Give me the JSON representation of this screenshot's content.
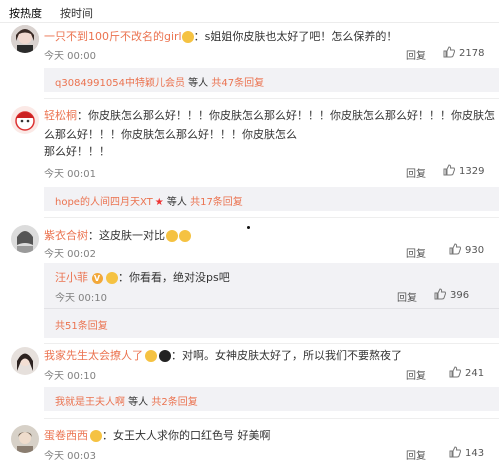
{
  "sort": {
    "hot": "按热度",
    "time": "按时间"
  },
  "c1": {
    "user": "一只不到100斤不改名的girl",
    "text": "：s姐姐你皮肤也太好了吧！怎么保养的！",
    "time": "今天 00:00",
    "reply": "回复",
    "likes": "2178",
    "sub_user": "q3084991054中特颖儿会员",
    "sub_mid": " 等人 ",
    "sub_count": "共47条回复"
  },
  "c2": {
    "user": "轻松桐",
    "text1": "：你皮肤怎么那么好！！！你皮肤怎么那么好！！！你皮肤怎么那么好！！！你皮肤怎么那么好！！！你皮肤怎么那么好！！！你皮肤怎么",
    "text2": "那么好！！！",
    "time": "今天 00:01",
    "reply": "回复",
    "likes": "1329",
    "sub_user": "hope的人间四月天XT",
    "sub_mid": " 等人 ",
    "sub_count": "共17条回复"
  },
  "c3": {
    "user": "紫衣合树",
    "text": "：这皮肤一对比",
    "time": "今天 00:02",
    "reply": "回复",
    "likes": "930",
    "r_user": "汪小菲",
    "r_text": "：你看看，绝对没ps吧",
    "r_time": "今天 00:10",
    "r_reply": "回复",
    "r_likes": "396",
    "more": "共51条回复"
  },
  "c4": {
    "user": "我家先生太会撩人了",
    "text": "：对啊。女神皮肤太好了，所以我们不要熬夜了",
    "time": "今天 00:10",
    "reply": "回复",
    "likes": "241",
    "sub_user": "我就是王夫人啊",
    "sub_mid": " 等人 ",
    "sub_count": "共2条回复"
  },
  "c5": {
    "user": "蛋卷西西",
    "text": "：女王大人求你的口红色号 好美啊",
    "time": "今天 00:03",
    "reply": "回复",
    "likes": "143"
  },
  "colors": {
    "link": "#eb7350",
    "reply_bg": "#f2f2f5",
    "badge": "#f2a83a"
  }
}
